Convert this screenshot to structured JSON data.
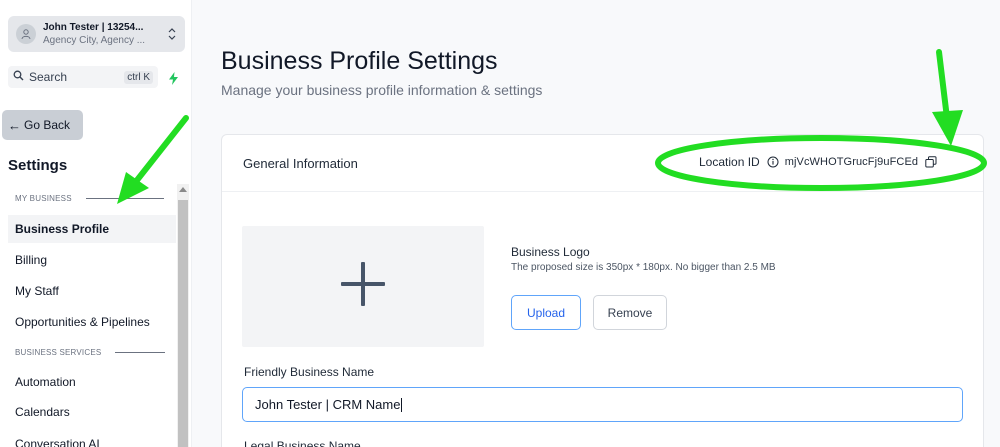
{
  "account": {
    "name": "John Tester | 13254...",
    "location": "Agency City, Agency ..."
  },
  "search": {
    "label": "Search",
    "shortcut": "ctrl K"
  },
  "sidebar": {
    "go_back": "Go Back",
    "title": "Settings",
    "sections": [
      {
        "heading": "MY BUSINESS",
        "items": [
          "Business Profile",
          "Billing",
          "My Staff",
          "Opportunities & Pipelines"
        ]
      },
      {
        "heading": "BUSINESS SERVICES",
        "items": [
          "Automation",
          "Calendars",
          "Conversation AI"
        ]
      }
    ],
    "active_item": "Business Profile"
  },
  "page": {
    "title": "Business Profile Settings",
    "subtitle": "Manage your business profile information & settings"
  },
  "general": {
    "title": "General Information",
    "location_label": "Location ID",
    "location_id": "mjVcWHOTGrucFj9uFCEd",
    "logo_label": "Business Logo",
    "logo_hint": "The proposed size is 350px * 180px. No bigger than 2.5 MB",
    "upload_label": "Upload",
    "remove_label": "Remove",
    "friendly_name_label": "Friendly Business Name",
    "friendly_name_value": "John Tester | CRM Name",
    "legal_name_label": "Legal Business Name"
  },
  "colors": {
    "accent_blue": "#2563eb",
    "annotation_green": "#22dd22",
    "bolt_green": "#22c55e"
  },
  "icons": {
    "avatar": "user-icon",
    "account_switch": "chevrons-up-down-icon",
    "search": "search-icon",
    "bolt": "lightning-icon",
    "back": "arrow-left-icon",
    "info": "info-icon",
    "copy": "copy-icon",
    "logo_placeholder": "plus-icon"
  }
}
